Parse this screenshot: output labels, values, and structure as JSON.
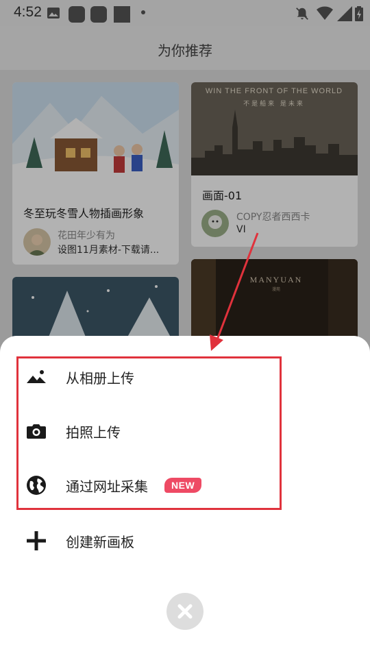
{
  "status_bar": {
    "time": "4:52"
  },
  "header": {
    "title": "为你推荐"
  },
  "feed": {
    "cards": [
      {
        "title": "冬至玩冬雪人物插画形象",
        "author": "花田年少有为",
        "description": "设图11月素材-下载请..."
      },
      {
        "title": "画面-01",
        "author": "COPY忍者西西卡",
        "description": "VI",
        "image_text_top": "WIN THE FRONT OF THE WORLD",
        "image_text_sub": "不是船来 是未来"
      },
      {
        "title": "",
        "author": "",
        "description": ""
      },
      {
        "title": "",
        "author": "",
        "description": "",
        "image_text_top": "MANYUAN",
        "image_text_sub": "漫苑"
      }
    ]
  },
  "sheet": {
    "items": [
      {
        "label": "从相册上传",
        "icon": "image-icon"
      },
      {
        "label": "拍照上传",
        "icon": "camera-icon"
      },
      {
        "label": "通过网址采集",
        "icon": "globe-icon",
        "badge": "NEW"
      },
      {
        "label": "创建新画板",
        "icon": "plus-icon"
      }
    ],
    "close_icon": "close-icon"
  },
  "colors": {
    "accent": "#e0323c",
    "badge": "#ee4a64"
  }
}
